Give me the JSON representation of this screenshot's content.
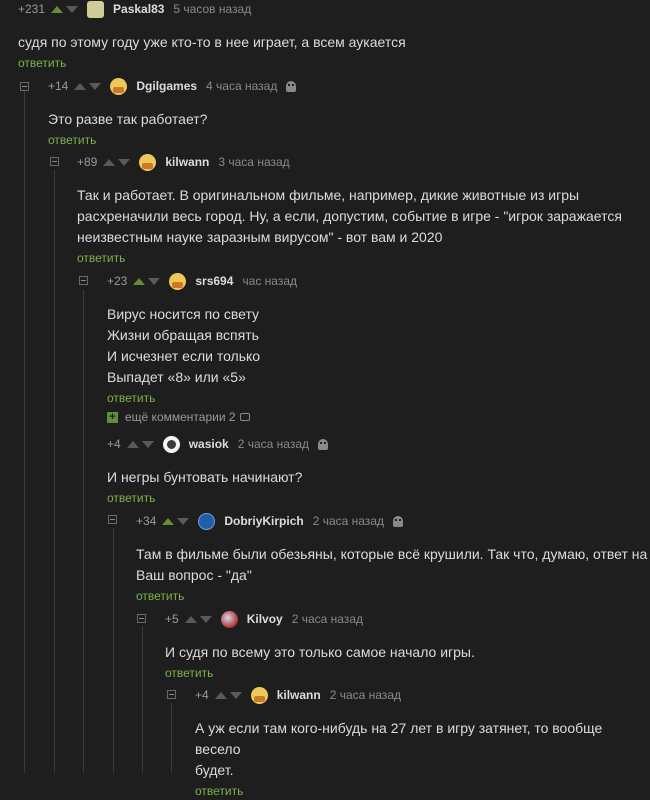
{
  "reply_label": "ответить",
  "more_comments": "ещё комментарии 2",
  "comments": [
    {
      "rating": "+231",
      "user": "Paskal83",
      "time": "5 часов назад",
      "text": "судя по этому году уже кто-то в нее играет, а всем аукается"
    },
    {
      "rating": "+14",
      "user": "Dgilgames",
      "time": "4 часа назад",
      "text": "Это разве так работает?"
    },
    {
      "rating": "+89",
      "user": "kilwann",
      "time": "3 часа назад",
      "text": "Так и работает. В оригинальном фильме, например, дикие животные из игры\nрасхреначили весь город. Ну, а если, допустим, событие в игре - \"игрок заражается\nнеизвестным науке заразным вирусом\" - вот вам и 2020"
    },
    {
      "rating": "+23",
      "user": "srs694",
      "time": "час назад",
      "text": "Вирус носится по свету\nЖизни обращая вспять\nИ исчезнет если только\nВыпадет «8» или «5»"
    },
    {
      "rating": "+4",
      "user": "wasiok",
      "time": "2 часа назад",
      "text": "И негры бунтовать начинают?"
    },
    {
      "rating": "+34",
      "user": "DobriyKirpich",
      "time": "2 часа назад",
      "text": "Там в фильме были обезьяны, которые всё крушили. Так что, думаю, ответ на\nВаш вопрос - \"да\""
    },
    {
      "rating": "+5",
      "user": "Kilvoy",
      "time": "2 часа назад",
      "text": "И судя по всему это только самое начало игры."
    },
    {
      "rating": "+4",
      "user": "kilwann",
      "time": "2 часа назад",
      "text": "А уж если там кого-нибудь на 27 лет в игру затянет, то вообще весело\nбудет."
    }
  ]
}
